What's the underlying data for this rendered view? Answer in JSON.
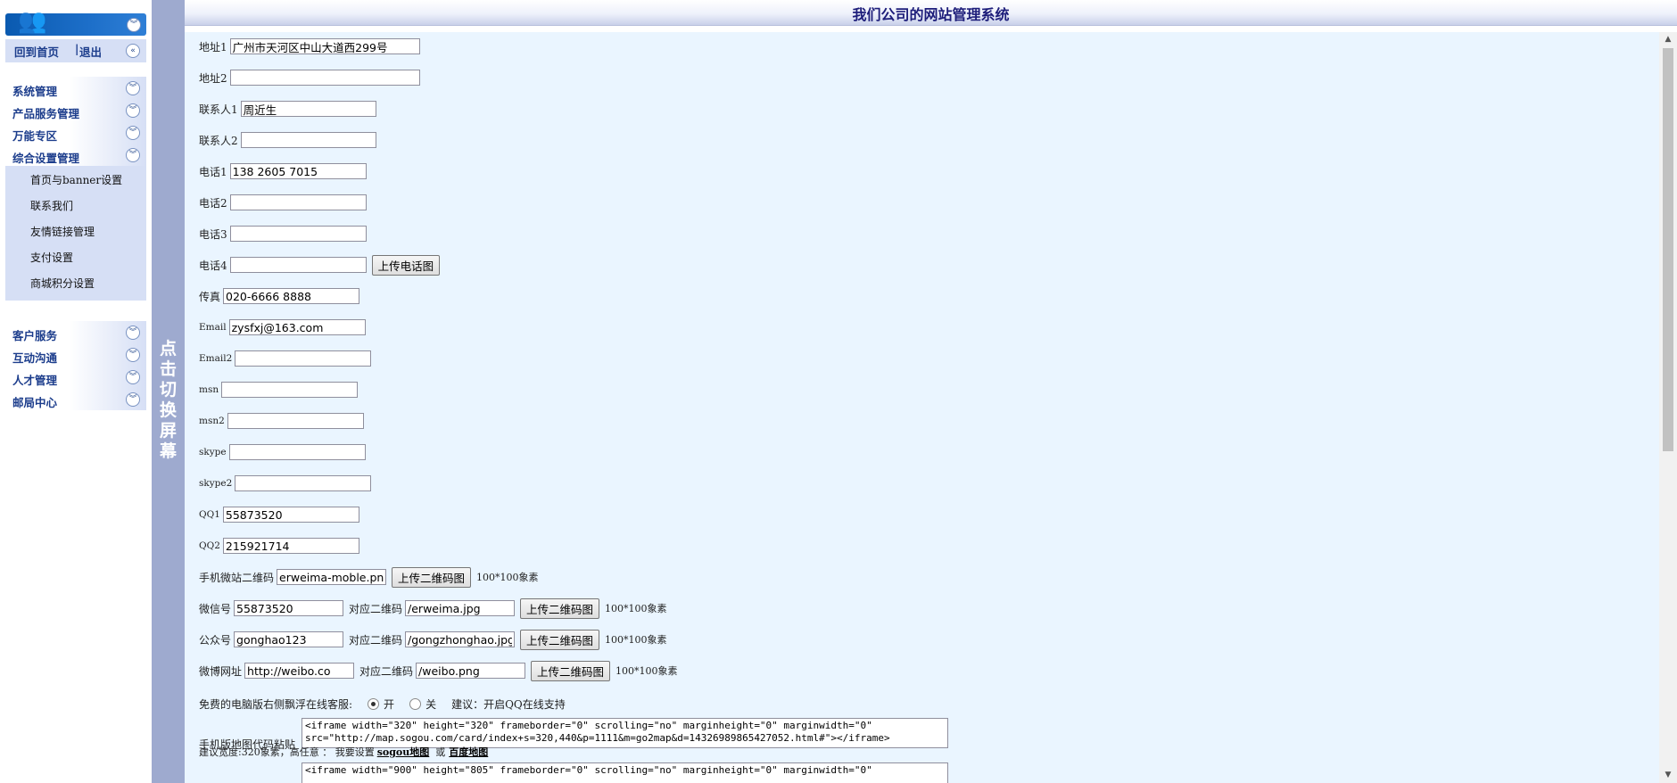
{
  "app": {
    "title": "我们公司的网站管理系统"
  },
  "sidebar": {
    "home_link": "回到首页",
    "separator": "|",
    "logout_link": "退出",
    "groups1": [
      {
        "label": "系统管理"
      },
      {
        "label": "产品服务管理"
      },
      {
        "label": "万能专区"
      },
      {
        "label": "综合设置管理"
      }
    ],
    "submenu": [
      {
        "label": "首页与banner设置"
      },
      {
        "label": "联系我们"
      },
      {
        "label": "友情链接管理"
      },
      {
        "label": "支付设置"
      },
      {
        "label": "商城积分设置"
      }
    ],
    "groups2": [
      {
        "label": "客户服务"
      },
      {
        "label": "互动沟通"
      },
      {
        "label": "人才管理"
      },
      {
        "label": "邮局中心"
      }
    ]
  },
  "toggle": {
    "text": "点击切换屏幕"
  },
  "form": {
    "address1": {
      "label": "地址1",
      "value": "广州市天河区中山大道西299号"
    },
    "address2": {
      "label": "地址2",
      "value": ""
    },
    "contact1": {
      "label": "联系人1",
      "value": "周近生"
    },
    "contact2": {
      "label": "联系人2",
      "value": ""
    },
    "phone1": {
      "label": "电话1",
      "value": "138 2605 7015"
    },
    "phone2": {
      "label": "电话2",
      "value": ""
    },
    "phone3": {
      "label": "电话3",
      "value": ""
    },
    "phone4": {
      "label": "电话4",
      "value": "",
      "button": "上传电话图"
    },
    "fax": {
      "label": "传真",
      "value": "020-6666 8888"
    },
    "email": {
      "label": "Email",
      "value": "zysfxj@163.com"
    },
    "email2": {
      "label": "Email2",
      "value": ""
    },
    "msn": {
      "label": "msn",
      "value": ""
    },
    "msn2": {
      "label": "msn2",
      "value": ""
    },
    "skype": {
      "label": "skype",
      "value": ""
    },
    "skype2": {
      "label": "skype2",
      "value": ""
    },
    "qq1": {
      "label": "QQ1",
      "value": "55873520"
    },
    "qq2": {
      "label": "QQ2",
      "value": "215921714"
    },
    "mobile_qr": {
      "label": "手机微站二维码",
      "value": "erweima-moble.png",
      "button": "上传二维码图",
      "note": "100*100象素"
    },
    "wechat": {
      "label": "微信号",
      "value": "55873520",
      "qr_label": "对应二维码",
      "qr_value": "/erweima.jpg",
      "button": "上传二维码图",
      "note": "100*100象素"
    },
    "official": {
      "label": "公众号",
      "value": "gonghao123",
      "qr_label": "对应二维码",
      "qr_value": "/gongzhonghao.jpg",
      "button": "上传二维码图",
      "note": "100*100象素"
    },
    "weibo": {
      "label": "微博网址",
      "value": "http://weibo.co",
      "qr_label": "对应二维码",
      "qr_value": "/weibo.png",
      "button": "上传二维码图",
      "note": "100*100象素"
    },
    "float_service": {
      "label": "免费的电脑版右侧飘浮在线客服:",
      "on_label": "开",
      "off_label": "关",
      "selected": "开",
      "hint": "建议：开启QQ在线支持"
    },
    "mobile_map": {
      "label": "手机版地图代码粘贴",
      "code": "<iframe width=\"320\" height=\"320\" frameborder=\"0\" scrolling=\"no\" marginheight=\"0\" marginwidth=\"0\"\nsrc=\"http://map.sogou.com/card/index+s=320,440&p=1111&m=go2map&d=14326989865427052.html#\"></iframe>",
      "hint_prefix": "建议宽度:320象素，高任意 ： 我要设置",
      "link1": "sogou地图",
      "or": "或",
      "link2": "百度地图"
    },
    "pc_map": {
      "code": "<iframe width=\"900\" height=\"805\" frameborder=\"0\" scrolling=\"no\" marginheight=\"0\" marginwidth=\"0\""
    }
  }
}
